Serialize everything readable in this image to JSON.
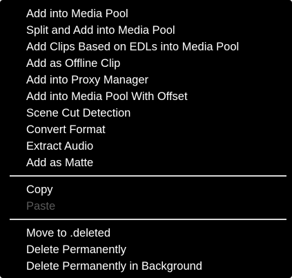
{
  "colors": {
    "background": "#000000",
    "text": "#ffffff",
    "disabled_text": "#5a5a5a",
    "separator": "#d9d9d9"
  },
  "menu": {
    "group1": [
      {
        "label": "Add into Media Pool",
        "enabled": true
      },
      {
        "label": "Split and Add into Media Pool",
        "enabled": true
      },
      {
        "label": "Add Clips Based on EDLs into Media Pool",
        "enabled": true
      },
      {
        "label": "Add as Offline Clip",
        "enabled": true
      },
      {
        "label": "Add into Proxy Manager",
        "enabled": true
      },
      {
        "label": "Add into Media Pool With Offset",
        "enabled": true
      },
      {
        "label": "Scene Cut Detection",
        "enabled": true
      },
      {
        "label": "Convert Format",
        "enabled": true
      },
      {
        "label": "Extract Audio",
        "enabled": true
      },
      {
        "label": "Add as Matte",
        "enabled": true
      }
    ],
    "group2": [
      {
        "label": "Copy",
        "enabled": true
      },
      {
        "label": "Paste",
        "enabled": false
      }
    ],
    "group3": [
      {
        "label": "Move to .deleted",
        "enabled": true
      },
      {
        "label": "Delete Permanently",
        "enabled": true
      },
      {
        "label": "Delete Permanently in Background",
        "enabled": true
      }
    ]
  }
}
